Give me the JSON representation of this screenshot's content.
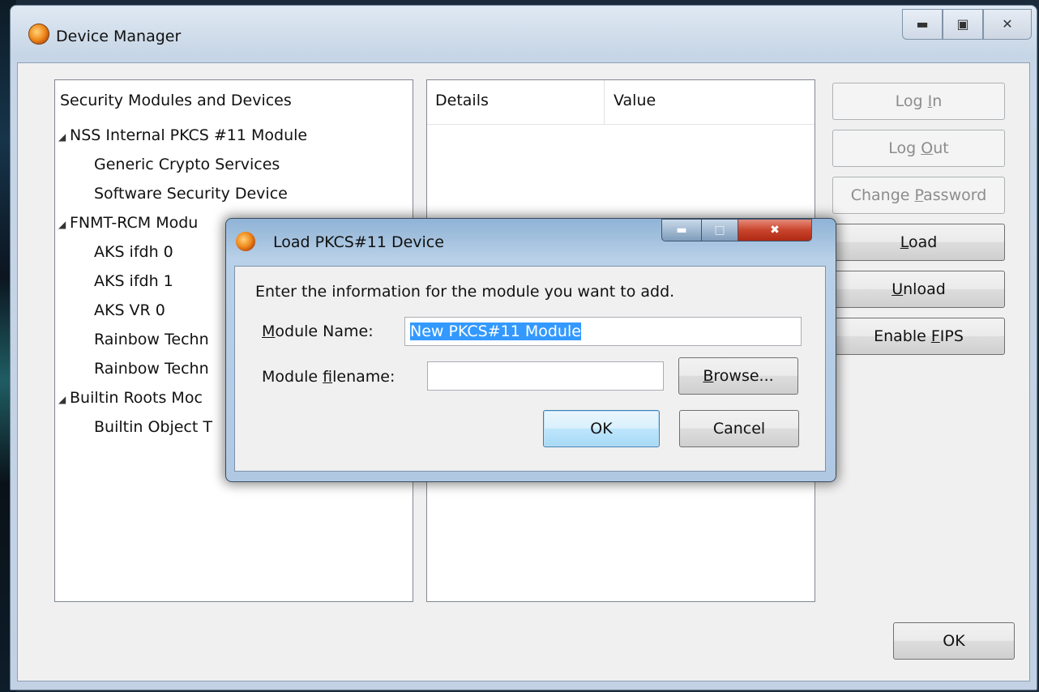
{
  "main_window": {
    "title": "Device Manager"
  },
  "tree": {
    "header": "Security Modules and Devices",
    "rows": [
      {
        "label": "NSS Internal PKCS #11 Module",
        "level": 0
      },
      {
        "label": "Generic Crypto Services",
        "level": 1
      },
      {
        "label": "Software Security Device",
        "level": 1
      },
      {
        "label": "FNMT-RCM Modu",
        "level": 0
      },
      {
        "label": "AKS ifdh 0",
        "level": 1
      },
      {
        "label": "AKS ifdh 1",
        "level": 1
      },
      {
        "label": "AKS VR 0",
        "level": 1
      },
      {
        "label": "Rainbow Techn",
        "level": 1
      },
      {
        "label": "Rainbow Techn",
        "level": 1
      },
      {
        "label": "Builtin Roots Moc",
        "level": 0
      },
      {
        "label": "Builtin Object T",
        "level": 1
      }
    ]
  },
  "details": {
    "col_details": "Details",
    "col_value": "Value"
  },
  "buttons": {
    "login_pre": "Log ",
    "login_u": "I",
    "login_post": "n",
    "logout_pre": "Log ",
    "logout_u": "O",
    "logout_post": "ut",
    "changepw_pre": "Change ",
    "changepw_u": "P",
    "changepw_post": "assword",
    "load_u": "L",
    "load_post": "oad",
    "unload_u": "U",
    "unload_post": "nload",
    "fips_pre": "Enable ",
    "fips_u": "F",
    "fips_post": "IPS",
    "ok": "OK"
  },
  "dialog": {
    "title": "Load PKCS#11 Device",
    "message": "Enter the information for the module you want to add.",
    "module_name_u": "M",
    "module_name_post": "odule Name:",
    "module_name_value": "New PKCS#11 Module",
    "module_filename_pre": "Module ",
    "module_filename_u": "f",
    "module_filename_post": "ilename:",
    "module_filename_value": "",
    "browse_u": "B",
    "browse_post": "rowse...",
    "ok": "OK",
    "cancel": "Cancel"
  },
  "icons": {
    "app": "firefox-icon",
    "expand": "expanded-triangle-icon"
  }
}
